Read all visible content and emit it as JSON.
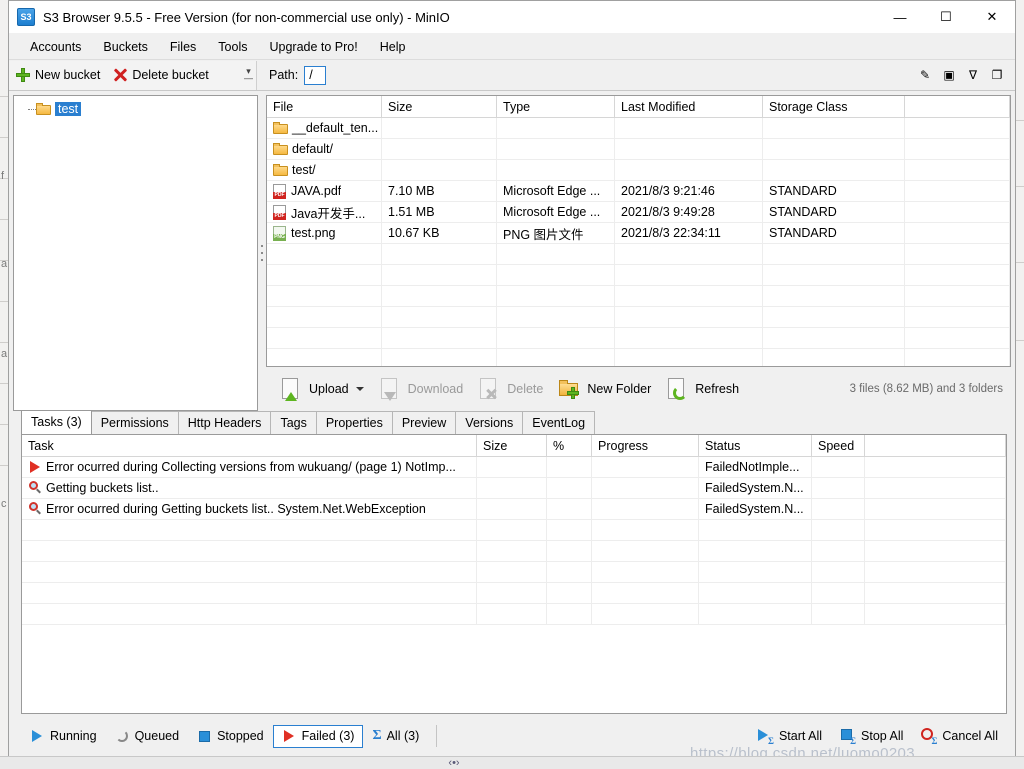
{
  "window": {
    "title": "S3 Browser 9.5.5 - Free Version (for non-commercial use only) - MinIO",
    "app_icon": "S3",
    "minimize": "—",
    "maximize": "☐",
    "close": "✕"
  },
  "menu": {
    "items": [
      {
        "label": "Accounts"
      },
      {
        "label": "Buckets"
      },
      {
        "label": "Files"
      },
      {
        "label": "Tools"
      },
      {
        "label": "Upgrade to Pro!"
      },
      {
        "label": "Help"
      }
    ]
  },
  "toolbar": {
    "new_bucket": "New bucket",
    "delete_bucket": "Delete bucket",
    "overflow": "≡",
    "path_label": "Path:",
    "path_value": "/",
    "right_icons": [
      {
        "name": "pencil-icon",
        "glyph": "✎"
      },
      {
        "name": "panel-icon",
        "glyph": "▣"
      },
      {
        "name": "filter-icon",
        "glyph": "∇"
      },
      {
        "name": "copy-icon",
        "glyph": "❐"
      }
    ]
  },
  "tree": {
    "bucket": "test"
  },
  "file_list": {
    "columns": [
      "File",
      "Size",
      "Type",
      "Last Modified",
      "Storage Class"
    ],
    "rows": [
      {
        "icon": "folder-icon",
        "file": "__default_ten...",
        "size": "",
        "type": "",
        "modified": "",
        "storage": ""
      },
      {
        "icon": "folder-icon",
        "file": "default/",
        "size": "",
        "type": "",
        "modified": "",
        "storage": ""
      },
      {
        "icon": "folder-icon",
        "file": "test/",
        "size": "",
        "type": "",
        "modified": "",
        "storage": ""
      },
      {
        "icon": "pdf-icon",
        "file": "JAVA.pdf",
        "size": "7.10 MB",
        "type": "Microsoft Edge ...",
        "modified": "2021/8/3 9:21:46",
        "storage": "STANDARD"
      },
      {
        "icon": "pdf-icon",
        "file": "Java开发手...",
        "size": "1.51 MB",
        "type": "Microsoft Edge ...",
        "modified": "2021/8/3 9:49:28",
        "storage": "STANDARD"
      },
      {
        "icon": "png-icon",
        "file": "test.png",
        "size": "10.67 KB",
        "type": "PNG 图片文件",
        "modified": "2021/8/3 22:34:11",
        "storage": "STANDARD"
      }
    ]
  },
  "actions": {
    "upload": "Upload",
    "download": "Download",
    "delete": "Delete",
    "new_folder": "New Folder",
    "refresh": "Refresh",
    "summary": "3 files (8.62 MB) and 3 folders"
  },
  "tabs": [
    {
      "label": "Tasks (3)",
      "active": true
    },
    {
      "label": "Permissions",
      "active": false
    },
    {
      "label": "Http Headers",
      "active": false
    },
    {
      "label": "Tags",
      "active": false
    },
    {
      "label": "Properties",
      "active": false
    },
    {
      "label": "Preview",
      "active": false
    },
    {
      "label": "Versions",
      "active": false
    },
    {
      "label": "EventLog",
      "active": false
    }
  ],
  "task_grid": {
    "columns": [
      "Task",
      "Size",
      "%",
      "Progress",
      "Status",
      "Speed"
    ],
    "rows": [
      {
        "icon": "play-icon",
        "task": "Error ocurred during Collecting versions from wukuang/ (page 1) NotImp...",
        "size": "",
        "pct": "",
        "progress": "",
        "status": "FailedNotImple...",
        "speed": ""
      },
      {
        "icon": "magnifier-icon",
        "task": "Getting buckets list..",
        "size": "",
        "pct": "",
        "progress": "",
        "status": "FailedSystem.N...",
        "speed": ""
      },
      {
        "icon": "magnifier-icon",
        "task": "Error ocurred during Getting buckets list.. System.Net.WebException",
        "size": "",
        "pct": "",
        "progress": "",
        "status": "FailedSystem.N...",
        "speed": ""
      }
    ]
  },
  "status_bar": {
    "filters": [
      {
        "label": "Running",
        "icon": "play-blue-icon",
        "selected": false
      },
      {
        "label": "Queued",
        "icon": "spinner-icon",
        "selected": false
      },
      {
        "label": "Stopped",
        "icon": "stop-square-icon",
        "selected": false
      },
      {
        "label": "Failed (3)",
        "icon": "play-red-icon",
        "selected": true
      },
      {
        "label": "All (3)",
        "icon": "sigma-icon",
        "selected": false
      }
    ],
    "sigma": "Σ",
    "start_all": "Start All",
    "stop_all": "Stop All",
    "cancel_all": "Cancel All"
  },
  "watermark": "https://blog.csdn.net/luomo0203",
  "resize_grip": "‹•›",
  "colors": {
    "accent": "#2a7fd0",
    "selection": "#2a7fd0",
    "error": "#e03024",
    "folder": "#f5b942",
    "green": "#5db520"
  }
}
